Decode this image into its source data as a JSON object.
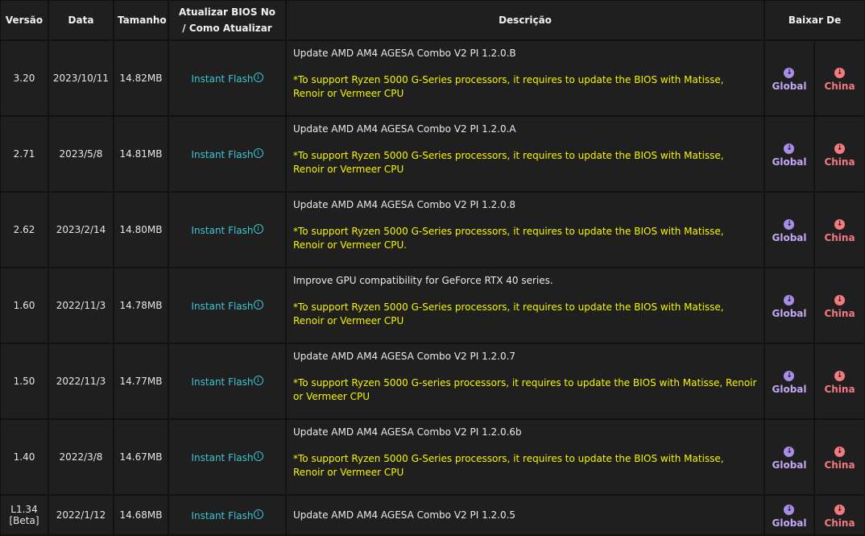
{
  "headers": {
    "version": "Versão",
    "date": "Data",
    "size": "Tamanho",
    "update_line1": "Atualizar BIOS No",
    "update_line2": "/ Como Atualizar",
    "description": "Descrição",
    "download": "Baixar De"
  },
  "labels": {
    "flash": "Instant Flash",
    "info_glyph": "i",
    "global": "Global",
    "china": "China",
    "down_arrow": "↓"
  },
  "colors": {
    "note_text": "#f5f500",
    "flash_link": "#3cc7d4",
    "global": "#c3a7f5",
    "china": "#f27a80"
  },
  "icons": {
    "info": "info-icon",
    "download": "download-arrow-icon"
  },
  "rows": [
    {
      "version": "3.20",
      "version_tag": "",
      "date": "2023/10/11",
      "size": "14.82MB",
      "desc": "Update AMD AM4 AGESA Combo V2 PI 1.2.0.B",
      "note": "*To support Ryzen 5000 G-Series processors, it requires to update the BIOS with Matisse, Renoir or Vermeer CPU"
    },
    {
      "version": "2.71",
      "version_tag": "",
      "date": "2023/5/8",
      "size": "14.81MB",
      "desc": "Update AMD AM4 AGESA Combo V2 PI 1.2.0.A",
      "note": "*To support Ryzen 5000 G-Series processors, it requires to update the BIOS with Matisse, Renoir or Vermeer CPU"
    },
    {
      "version": "2.62",
      "version_tag": "",
      "date": "2023/2/14",
      "size": "14.80MB",
      "desc": "Update AMD AM4 AGESA Combo V2 PI 1.2.0.8",
      "note": "*To support Ryzen 5000 G-Series processors, it requires to update the BIOS with Matisse, Renoir or Vermeer CPU."
    },
    {
      "version": "1.60",
      "version_tag": "",
      "date": "2022/11/3",
      "size": "14.78MB",
      "desc": "Improve GPU compatibility for GeForce RTX 40 series.",
      "note": "*To support Ryzen 5000 G-Series processors, it requires to update the BIOS with Matisse, Renoir or Vermeer CPU"
    },
    {
      "version": "1.50",
      "version_tag": "",
      "date": "2022/11/3",
      "size": "14.77MB",
      "desc": "Update AMD AM4 AGESA Combo V2 PI 1.2.0.7",
      "note": "*To support Ryzen 5000 G-series processors, it requires to update the BIOS with Matisse, Renoir or Vermeer CPU"
    },
    {
      "version": "1.40",
      "version_tag": "",
      "date": "2022/3/8",
      "size": "14.67MB",
      "desc": "Update AMD AM4 AGESA Combo V2 PI 1.2.0.6b",
      "note": "*To support Ryzen 5000 G-Series processors, it requires to update the BIOS with Matisse, Renoir or Vermeer CPU"
    },
    {
      "version": "L1.34",
      "version_tag": "[Beta]",
      "date": "2022/1/12",
      "size": "14.68MB",
      "desc": "Update AMD AM4 AGESA Combo V2 PI 1.2.0.5",
      "note": ""
    }
  ]
}
